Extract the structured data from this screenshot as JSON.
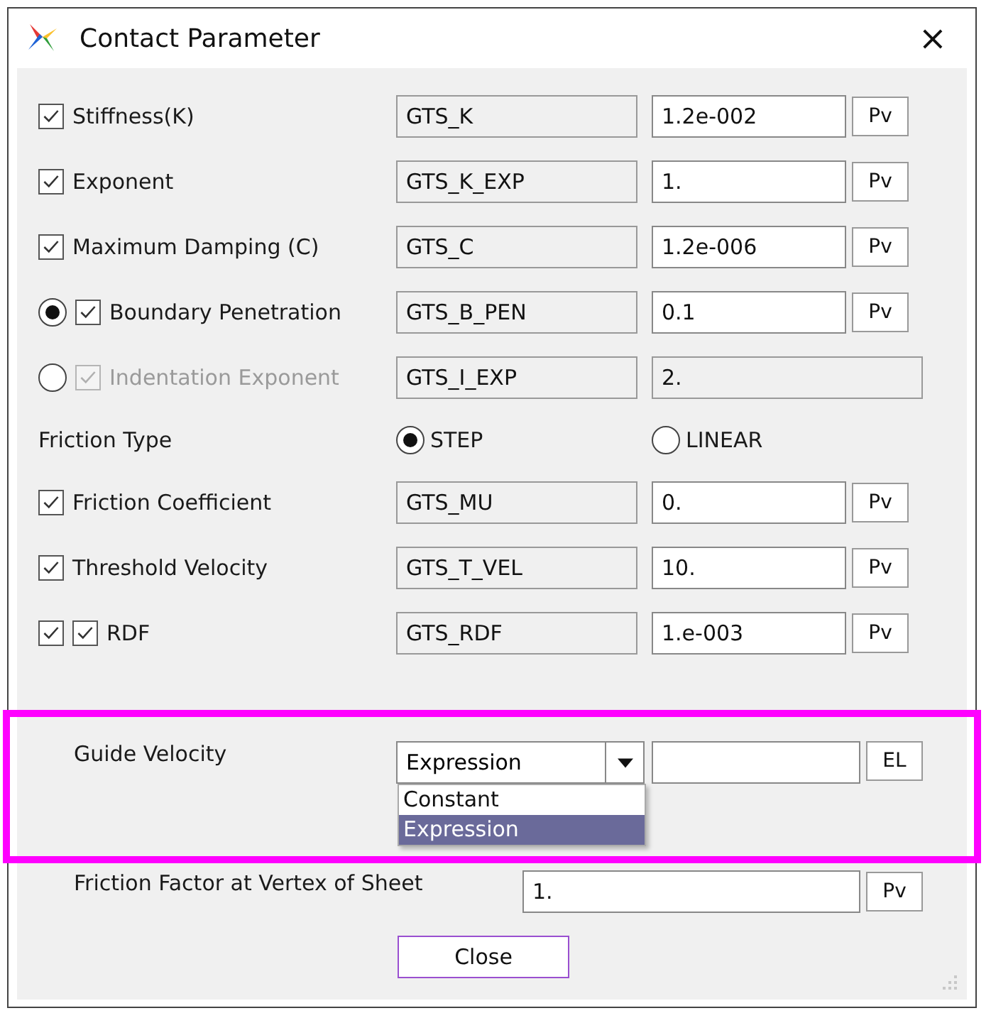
{
  "window": {
    "title": "Contact Parameter",
    "close": "×"
  },
  "parameters": [
    {
      "checks": [
        {
          "checked": true
        }
      ],
      "label": "Stiffness(K)",
      "name": "GTS_K",
      "value": "1.2e-002",
      "button": "Pv",
      "disabled": false
    },
    {
      "checks": [
        {
          "checked": true
        }
      ],
      "label": "Exponent",
      "name": "GTS_K_EXP",
      "value": "1.",
      "button": "Pv",
      "disabled": false
    },
    {
      "checks": [
        {
          "checked": true
        }
      ],
      "label": "Maximum Damping (C)",
      "name": "GTS_C",
      "value": "1.2e-006",
      "button": "Pv",
      "disabled": false
    },
    {
      "radio": {
        "selected": true
      },
      "checks": [
        {
          "checked": true
        }
      ],
      "label": "Boundary Penetration",
      "name": "GTS_B_PEN",
      "value": "0.1",
      "button": "Pv",
      "disabled": false
    },
    {
      "radio": {
        "selected": false
      },
      "checks": [
        {
          "checked": true
        }
      ],
      "label": "Indentation Exponent",
      "name": "GTS_I_EXP",
      "value": "2.",
      "disabled": true
    }
  ],
  "friction_type": {
    "label": "Friction Type",
    "options": [
      {
        "label": "STEP",
        "selected": true
      },
      {
        "label": "LINEAR",
        "selected": false
      }
    ]
  },
  "friction_parameters": [
    {
      "checks": [
        {
          "checked": true
        }
      ],
      "label": "Friction Coefficient",
      "name": "GTS_MU",
      "value": "0.",
      "button": "Pv",
      "disabled": false
    },
    {
      "checks": [
        {
          "checked": true
        }
      ],
      "label": "Threshold Velocity",
      "name": "GTS_T_VEL",
      "value": "10.",
      "button": "Pv",
      "disabled": false
    },
    {
      "checks": [
        {
          "checked": true
        },
        {
          "checked": true
        }
      ],
      "label": "RDF",
      "name": "GTS_RDF",
      "value": "1.e-003",
      "button": "Pv",
      "disabled": false
    }
  ],
  "guide_velocity": {
    "highlighted": true,
    "label": "Guide Velocity",
    "dropdown": {
      "value": "Expression",
      "expanded": true,
      "options": [
        {
          "label": "Constant",
          "selected": false
        },
        {
          "label": "Expression",
          "selected": true
        }
      ]
    },
    "button": "EL"
  },
  "friction_factor": {
    "label": "Friction Factor at Vertex of Sheet",
    "value": "1.",
    "button": "Pv"
  },
  "close_button": "Close"
}
